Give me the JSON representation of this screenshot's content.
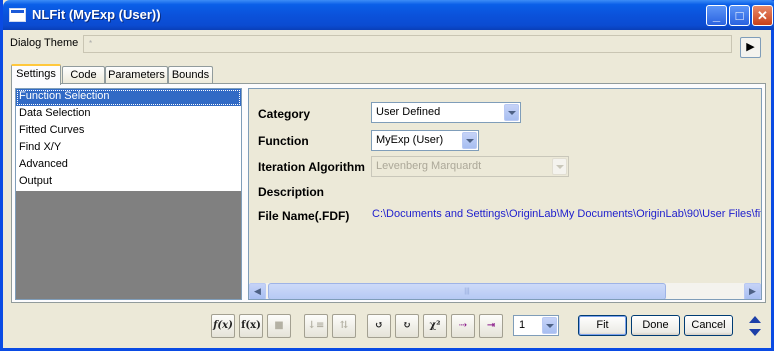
{
  "window": {
    "title": "NLFit (MyExp (User))",
    "accent": "#0b52db"
  },
  "theme": {
    "label": "Dialog Theme",
    "value": "*",
    "arrow_glyph": "▶"
  },
  "tabs": [
    {
      "label": "Settings",
      "active": true
    },
    {
      "label": "Code",
      "active": false
    },
    {
      "label": "Parameters",
      "active": false
    },
    {
      "label": "Bounds",
      "active": false
    }
  ],
  "nav": {
    "items": [
      {
        "label": "Function Selection",
        "selected": true
      },
      {
        "label": "Data Selection",
        "selected": false
      },
      {
        "label": "Fitted Curves",
        "selected": false
      },
      {
        "label": "Find X/Y",
        "selected": false
      },
      {
        "label": "Advanced",
        "selected": false
      },
      {
        "label": "Output",
        "selected": false
      }
    ]
  },
  "form": {
    "category_label": "Category",
    "category_value": "User Defined",
    "function_label": "Function",
    "function_value": "MyExp (User)",
    "iteration_label": "Iteration Algorithm",
    "iteration_value": "Levenberg Marquardt",
    "description_label": "Description",
    "filename_label": "File Name(.FDF)",
    "filename_value": "C:\\Documents and Settings\\OriginLab\\My Documents\\OriginLab\\90\\User Files\\fit"
  },
  "scrollbar": {
    "left_glyph": "◀",
    "right_glyph": "▶",
    "thumb_grip": "|||"
  },
  "toolbar": {
    "tools": [
      {
        "name": "fx-edit-icon",
        "glyph": "f(x)",
        "enabled": true
      },
      {
        "name": "fx-new-icon",
        "glyph": "f(x)",
        "enabled": true
      },
      {
        "name": "save-icon",
        "glyph": "■",
        "enabled": false
      },
      {
        "name": "sort-down-icon",
        "glyph": "↓≡",
        "enabled": false
      },
      {
        "name": "sort-grid-icon",
        "glyph": "⇅",
        "enabled": false
      },
      {
        "name": "init-icon",
        "glyph": "↺",
        "enabled": true
      },
      {
        "name": "sort-reset-icon",
        "glyph": "↻",
        "enabled": true
      },
      {
        "name": "chi-square-icon",
        "glyph": "χ²",
        "enabled": true
      },
      {
        "name": "one-iteration-icon",
        "glyph": "⇢",
        "enabled": true
      },
      {
        "name": "fit-until-converged-icon",
        "glyph": "⇥",
        "enabled": true
      }
    ],
    "iterations_value": "1"
  },
  "buttons": {
    "fit": "Fit",
    "done": "Done",
    "cancel": "Cancel"
  }
}
